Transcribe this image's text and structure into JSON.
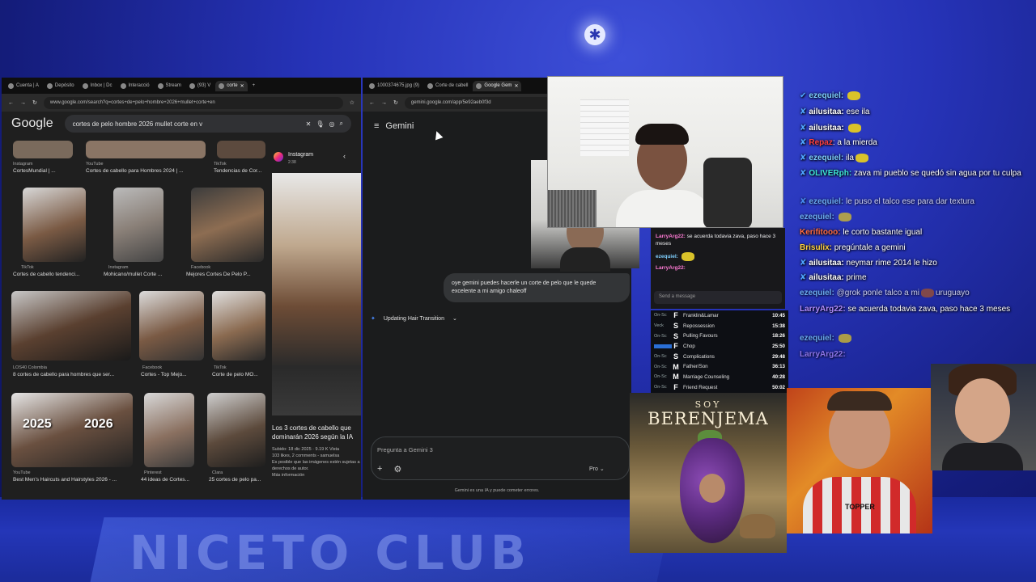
{
  "win1": {
    "tabs": [
      "Cuenta | A",
      "Depósito",
      "Inbox | Dc",
      "Interacció",
      "Stream",
      "(93) V",
      "corte"
    ],
    "url": "www.google.com/search?q=cortes+de+pelo+hombre+2026+mullet+corte+en",
    "search_query": "cortes de pelo hombre 2026 mullet corte en v",
    "logo": "Google",
    "results": [
      {
        "src": "Instagram",
        "title": "CortesMundial | ..."
      },
      {
        "src": "YouTube",
        "title": "Cortes de cabello para Hombres 2024 | ..."
      },
      {
        "src": "TikTok",
        "title": "Tendencias de Cor..."
      },
      {
        "src": "TikTok",
        "title": "Cortes de cabello tendenci..."
      },
      {
        "src": "Instagram",
        "title": "Mohicano/mullet Corte ..."
      },
      {
        "src": "Facebook",
        "title": "Mejores Cortes De Pelo P..."
      },
      {
        "src": "LOS40 Colombia",
        "title": "8 cortes de cabello para hombres que ser..."
      },
      {
        "src": "Facebook",
        "title": "Cortes - Top Mejo..."
      },
      {
        "src": "TikTok",
        "title": "Corte de pelo MO..."
      },
      {
        "src": "YouTube",
        "title": "Best Men's Haircuts and Hairstyles 2026 - ..."
      },
      {
        "src": "Pinterest",
        "title": "44 ideas de Cortes..."
      },
      {
        "src": "Clara",
        "title": "25 cortes de pelo pa..."
      }
    ],
    "thumb_labels": [
      "2025",
      "2026"
    ],
    "panel": {
      "src": "Instagram",
      "src_sub": "2:38",
      "title": "Los 3 cortes de cabello que dominarán 2026 según la IA",
      "meta1": "Subido: 18 dic 2025 · 9.19 K Vista",
      "meta2": "103 likes, 2 comments - samuelsa",
      "meta3": "Es posible que las imágenes estén sujetas a derechos de autor.",
      "meta4": "Más información"
    }
  },
  "win2": {
    "tabs": [
      "1000374675.jpg (9)",
      "Corte de cabell",
      "Google Gem"
    ],
    "url": "gemini.google.com/app/5e92aeb0f3d",
    "title": "Gemini",
    "user_msg": "oye gemini puedes hacerle un corte de pelo que le quede excelente a mi amigo chaleoff",
    "thinking": "Updating Hair Transition",
    "prompt_placeholder": "Pregunta a Gemini 3",
    "model": "Pro",
    "disclaimer": "Gemini es una IA y puede cometer errores."
  },
  "minichat": {
    "lines": [
      {
        "user": "LarryArg22:",
        "text": "se acuerda todavia zava, paso hace 3 meses"
      },
      {
        "user": "ezequiel:",
        "text": ""
      },
      {
        "user": "LarryArg22:",
        "text": ""
      }
    ],
    "send_placeholder": "Send a message"
  },
  "playlist": [
    {
      "st": "On-Sc",
      "ic": "F",
      "name": "Franklin&Lamar",
      "time": "10:45"
    },
    {
      "st": "Veck",
      "ic": "S",
      "name": "Repossession",
      "time": "15:38"
    },
    {
      "st": "On-Sc",
      "ic": "S",
      "name": "Pulling Favours",
      "time": "18:26"
    },
    {
      "st": "",
      "ic": "F",
      "name": "Chop",
      "time": "25:50"
    },
    {
      "st": "On-Sc",
      "ic": "S",
      "name": "Complications",
      "time": "29:48"
    },
    {
      "st": "On-Sc",
      "ic": "M",
      "name": "Father/Son",
      "time": "36:13"
    },
    {
      "st": "On-Sc",
      "ic": "M",
      "name": "Marriage Counseling",
      "time": "40:28"
    },
    {
      "st": "On-Sc",
      "ic": "F",
      "name": "Friend Request",
      "time": "50:02"
    }
  ],
  "poster": {
    "soy": "SOY",
    "title": "BERENJEMA"
  },
  "chat": [
    {
      "user": "ezequiel:",
      "text": "",
      "color": "#7fd0ff"
    },
    {
      "user": "ailusitaa:",
      "text": "ese ila",
      "color": "#ffffff"
    },
    {
      "user": "ailusitaa:",
      "text": "",
      "color": "#ffffff"
    },
    {
      "user": "Repaz",
      "text": ": a la mierda",
      "color": "#ff4040"
    },
    {
      "user": "ezequiel:",
      "text": "ila",
      "color": "#7fd0ff"
    },
    {
      "user": "OLIVERph:",
      "text": "zava mi pueblo se quedó sin agua por tu culpa",
      "color": "#3ee6d6"
    },
    {
      "user": "ezequiel:",
      "text": "le puso el talco ese para dar textura",
      "color": "#7fd0ff"
    },
    {
      "user": "ezequiel:",
      "text": "",
      "color": "#7fd0ff"
    },
    {
      "user": "Kerifitooo:",
      "text": "le corto bastante igual",
      "color": "#ff6a3d"
    },
    {
      "user": "Brisulix:",
      "text": "pregúntale a gemini",
      "color": "#ffd23e"
    },
    {
      "user": "ailusitaa:",
      "text": "neymar rime 2014 le hizo",
      "color": "#ffffff"
    },
    {
      "user": "ailusitaa:",
      "text": "prime",
      "color": "#ffffff"
    },
    {
      "user": "ezequiel:",
      "text": "@grok ponle talco a mi",
      "text2": "uruguayo",
      "color": "#7fd0ff"
    },
    {
      "user": "LarryArg22:",
      "text": "se acuerda todavia zava, paso hace 3 meses",
      "color": "#b08cff"
    },
    {
      "user": "ezequiel:",
      "text": "",
      "color": "#7fd0ff"
    },
    {
      "user": "LarryArg22:",
      "text": "",
      "color": "#b08cff"
    }
  ],
  "bg_text": "NICETO CLUB",
  "cam_center_text": "TOPPER"
}
